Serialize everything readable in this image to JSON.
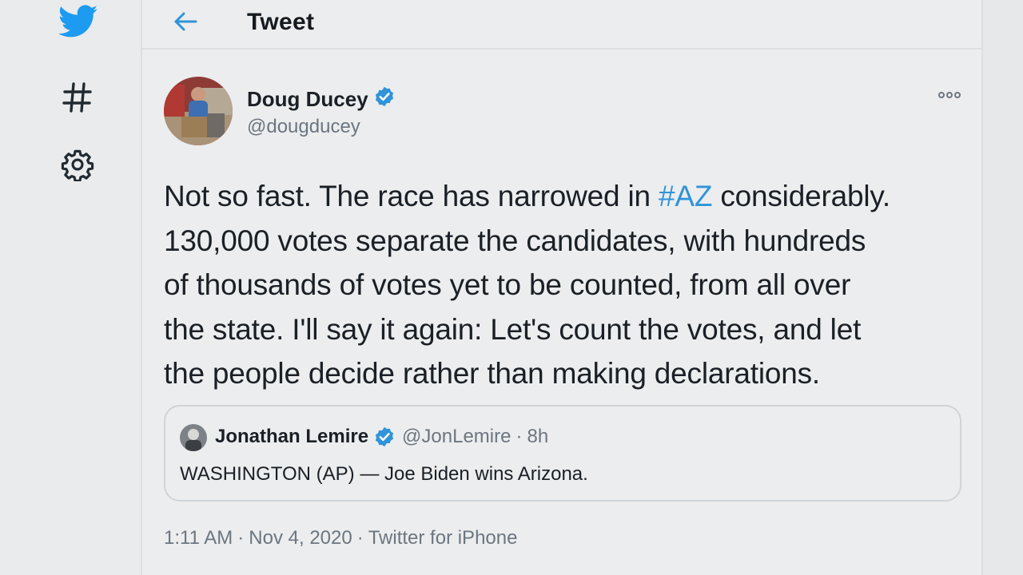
{
  "header": {
    "title": "Tweet"
  },
  "tweet": {
    "author": {
      "name": "Doug Ducey",
      "handle": "@dougducey",
      "verified": true
    },
    "text": {
      "line1_before": "Not so fast. The race has narrowed in ",
      "hashtag": "#AZ",
      "line1_after": " considerably.",
      "line2": "130,000 votes separate the candidates, with hundreds",
      "line3": "of thousands of votes yet to be counted, from all over",
      "line4": "the state. I'll say it again: Let's count the votes, and let",
      "line5": "the people decide rather than making declarations."
    },
    "quoted": {
      "name": "Jonathan Lemire",
      "handle": "@JonLemire",
      "separator": "·",
      "time": "8h",
      "text": "WASHINGTON (AP) — Joe Biden wins Arizona."
    },
    "meta": {
      "time": "1:11 AM",
      "date": "Nov 4, 2020",
      "separator": "·",
      "source": "Twitter for iPhone"
    }
  },
  "nav": {
    "icons": [
      "twitter-bird-icon",
      "hashtag-icon",
      "gear-icon"
    ]
  },
  "colors": {
    "accent": "#2f94da",
    "text": "#1a2026",
    "muted": "#6c7680",
    "background": "#ecedee"
  }
}
